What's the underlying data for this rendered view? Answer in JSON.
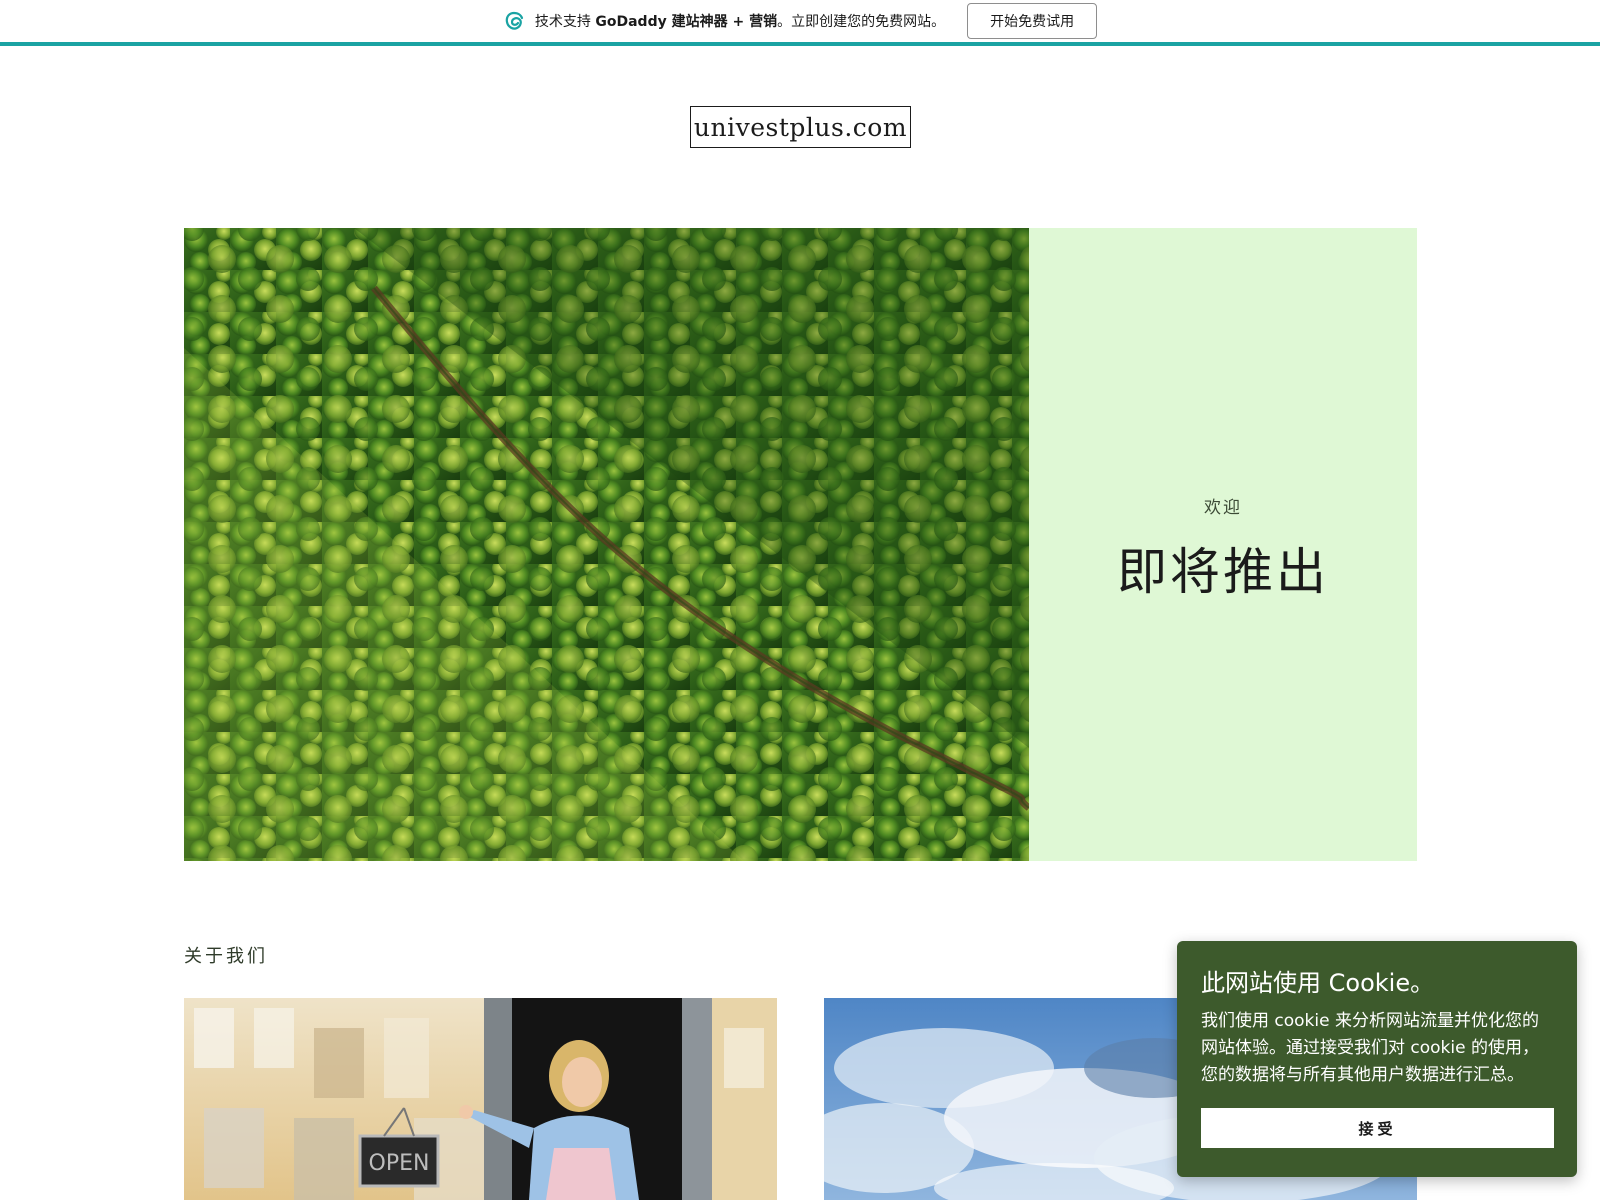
{
  "promo": {
    "text_prefix": "技术支持 ",
    "brand": "GoDaddy 建站神器 + 营销",
    "text_suffix": "。立即创建您的免费网站。",
    "cta_label": "开始免费试用",
    "accent_color": "#1aa3a3"
  },
  "site": {
    "logo_text": "univestplus.com"
  },
  "hero": {
    "kicker": "欢迎",
    "title": "即将推出",
    "panel_color": "#dff8d5",
    "image": "aerial-forest-photo"
  },
  "about": {
    "heading": "关于我们",
    "cards": [
      {
        "image": "shop-owner-open-sign-photo"
      },
      {
        "image": "blue-sky-clouds-photo"
      }
    ]
  },
  "cookie": {
    "title": "此网站使用 Cookie。",
    "text": "我们使用 cookie 来分析网站流量并优化您的网站体验。通过接受我们对 cookie 的使用，您的数据将与所有其他用户数据进行汇总。",
    "accept_label": "接受",
    "bg_color": "#3d5a2c"
  }
}
